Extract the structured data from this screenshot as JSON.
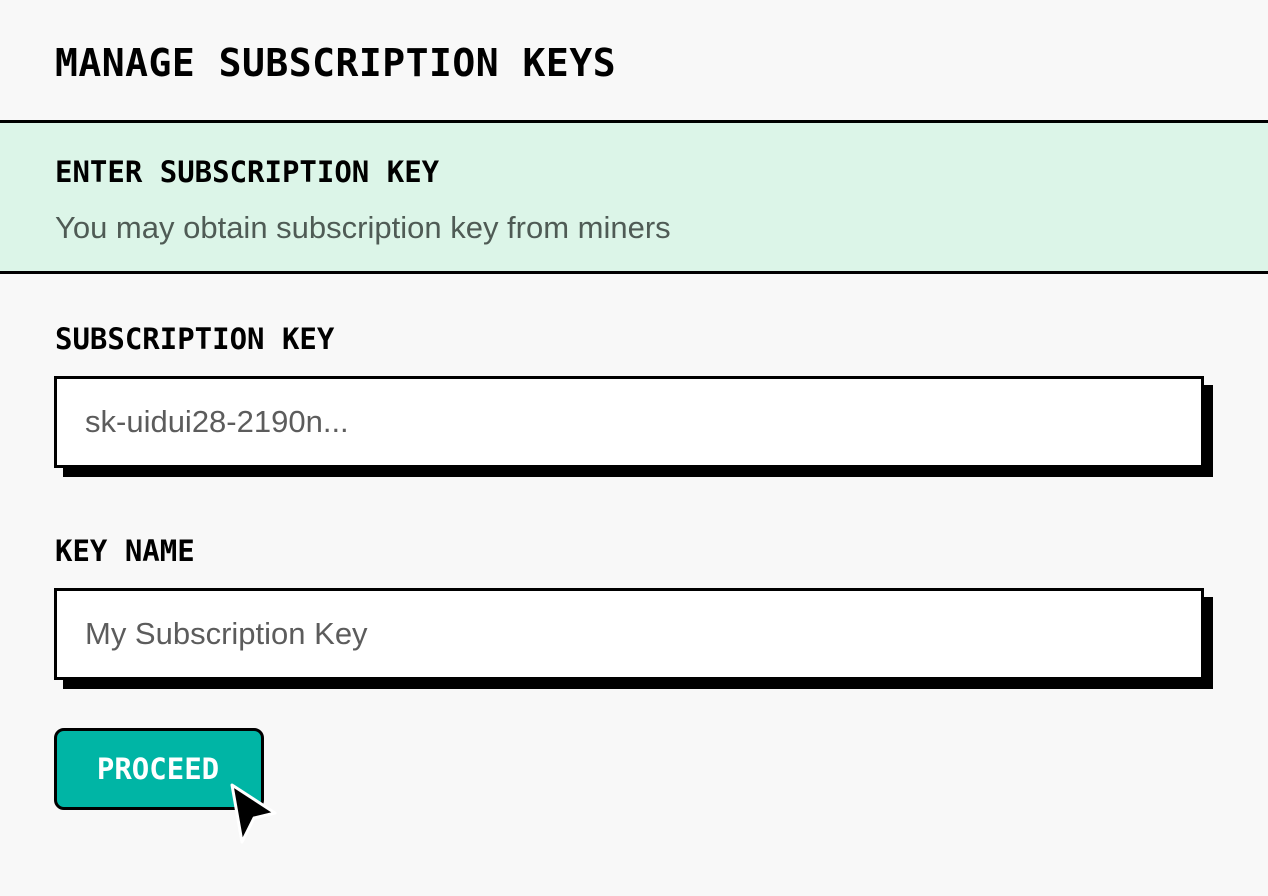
{
  "page": {
    "title": "MANAGE SUBSCRIPTION KEYS"
  },
  "banner": {
    "title": "ENTER SUBSCRIPTION KEY",
    "subtitle": "You may obtain subscription key from miners",
    "background_color": "#dcf5e8"
  },
  "form": {
    "subscription_key": {
      "label": "SUBSCRIPTION KEY",
      "value": "",
      "placeholder": "sk-uidui28-2190n..."
    },
    "key_name": {
      "label": "KEY NAME",
      "value": "",
      "placeholder": "My Subscription Key"
    },
    "proceed_label": "PROCEED",
    "accent_color": "#00b5a5"
  },
  "icons": {
    "cursor": "mouse-pointer-arrow-icon"
  }
}
